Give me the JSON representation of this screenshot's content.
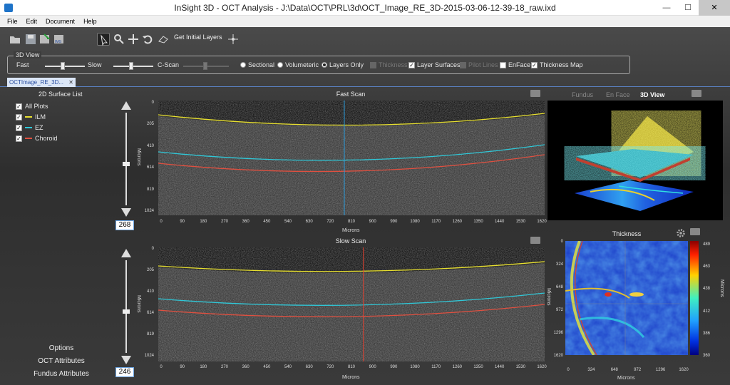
{
  "window": {
    "title": "InSight 3D - OCT Analysis - J:\\Data\\OCT\\PRL\\3d\\OCT_Image_RE_3D-2015-03-06-12-39-18_raw.ixd",
    "minimize": "—",
    "maximize": "☐",
    "close": "✕"
  },
  "menu": [
    "File",
    "Edit",
    "Document",
    "Help"
  ],
  "toolbar": {
    "get_initial_layers": "Get Initial Layers",
    "icons": [
      "open-folder-icon",
      "save-icon",
      "export-icon",
      "export-img-icon",
      "cursor-icon",
      "zoom-icon",
      "pan-icon",
      "undo-icon",
      "erase-icon",
      "add-point-icon"
    ],
    "export_img_text": "IMG"
  },
  "view3d_group": {
    "legend": "3D View",
    "fast": "Fast",
    "slow": "Slow",
    "cscan": "C-Scan",
    "radios": [
      {
        "label": "Sectional",
        "checked": false
      },
      {
        "label": "Volumeteric",
        "checked": false
      },
      {
        "label": "Layers Only",
        "checked": true
      }
    ],
    "checks": [
      {
        "label": "Thickness",
        "checked": false,
        "disabled": true
      },
      {
        "label": "Layer Surfaces",
        "checked": true,
        "disabled": false
      },
      {
        "label": "Pilot Lines",
        "checked": false,
        "disabled": true
      },
      {
        "label": "EnFace",
        "checked": false,
        "disabled": false
      },
      {
        "label": "Thickness Map",
        "checked": true,
        "disabled": false
      }
    ]
  },
  "doc_tab": {
    "label": "OCTImage_RE_3D...",
    "close": "✕"
  },
  "surface_list": {
    "title": "2D Surface List",
    "items": [
      {
        "label": "All Plots",
        "checked": true,
        "color": ""
      },
      {
        "label": "ILM",
        "checked": true,
        "color": "#e8e030"
      },
      {
        "label": "EZ",
        "checked": true,
        "color": "#30c8d8"
      },
      {
        "label": "Choroid",
        "checked": true,
        "color": "#e05040"
      }
    ]
  },
  "left_links": [
    "Options",
    "OCT Attributes",
    "Fundus Attributes"
  ],
  "fast_scan": {
    "title": "Fast Scan",
    "value": "268",
    "slider_level": 0.55,
    "yticks": [
      "0",
      "205",
      "410",
      "614",
      "819",
      "1024"
    ],
    "xticks": [
      "0",
      "90",
      "180",
      "270",
      "360",
      "450",
      "540",
      "630",
      "720",
      "810",
      "900",
      "990",
      "1080",
      "1170",
      "1260",
      "1350",
      "1440",
      "1530",
      "1620"
    ],
    "ylabel": "Microns",
    "xlabel": "Microns",
    "cursor_x": 780,
    "cursor_color": "#2a9ee0"
  },
  "slow_scan": {
    "title": "Slow Scan",
    "value": "246",
    "slider_level": 0.55,
    "yticks": [
      "0",
      "205",
      "410",
      "614",
      "819",
      "1024"
    ],
    "xticks": [
      "0",
      "90",
      "180",
      "270",
      "360",
      "450",
      "540",
      "630",
      "720",
      "810",
      "900",
      "990",
      "1080",
      "1170",
      "1260",
      "1350",
      "1440",
      "1530",
      "1620"
    ],
    "ylabel": "Microns",
    "xlabel": "Microns",
    "cursor_x": 860,
    "cursor_color": "#e04030"
  },
  "right_tabs": [
    {
      "label": "Fundus",
      "active": false
    },
    {
      "label": "En Face",
      "active": false
    },
    {
      "label": "3D View",
      "active": true
    }
  ],
  "thickness": {
    "title": "Thickness",
    "yticks": [
      "0",
      "324",
      "648",
      "972",
      "1296",
      "1620"
    ],
    "xticks": [
      "0",
      "324",
      "648",
      "972",
      "1296",
      "1620"
    ],
    "xlabel": "Microns",
    "ylabel": "Microns",
    "cb_ticks": [
      "489",
      "463",
      "438",
      "412",
      "386",
      "360"
    ],
    "cb_label": "Microns"
  }
}
